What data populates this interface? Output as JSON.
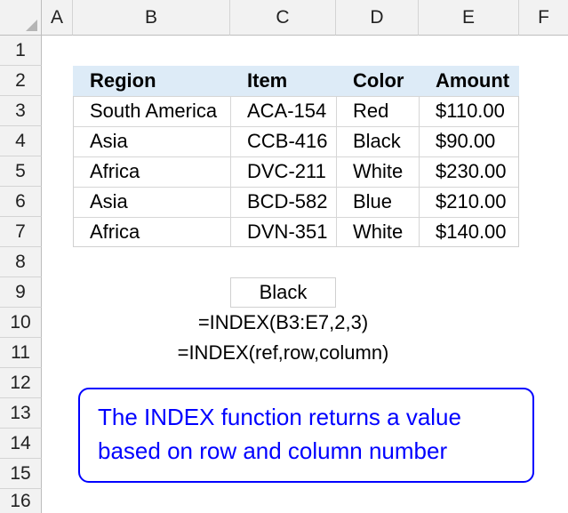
{
  "columns": [
    "A",
    "B",
    "C",
    "D",
    "E",
    "F"
  ],
  "rows": [
    "1",
    "2",
    "3",
    "4",
    "5",
    "6",
    "7",
    "8",
    "9",
    "10",
    "11",
    "12",
    "13",
    "14",
    "15",
    "16"
  ],
  "table": {
    "headers": [
      "Region",
      "Item",
      "Color",
      "Amount"
    ],
    "rows": [
      [
        "South America",
        "ACA-154",
        "Red",
        "$110.00"
      ],
      [
        "Asia",
        "CCB-416",
        "Black",
        "$90.00"
      ],
      [
        "Africa",
        "DVC-211",
        "White",
        "$230.00"
      ],
      [
        "Asia",
        "BCD-582",
        "Blue",
        "$210.00"
      ],
      [
        "Africa",
        "DVN-351",
        "White",
        "$140.00"
      ]
    ]
  },
  "result": "Black",
  "formula": "=INDEX(B3:E7,2,3)",
  "syntax": "=INDEX(ref,row,column)",
  "note": {
    "line1": "The INDEX function returns a value",
    "line2": "based on row and column number"
  },
  "colors": {
    "header_fill": "#ddebf7",
    "note_color": "#0000ff"
  }
}
